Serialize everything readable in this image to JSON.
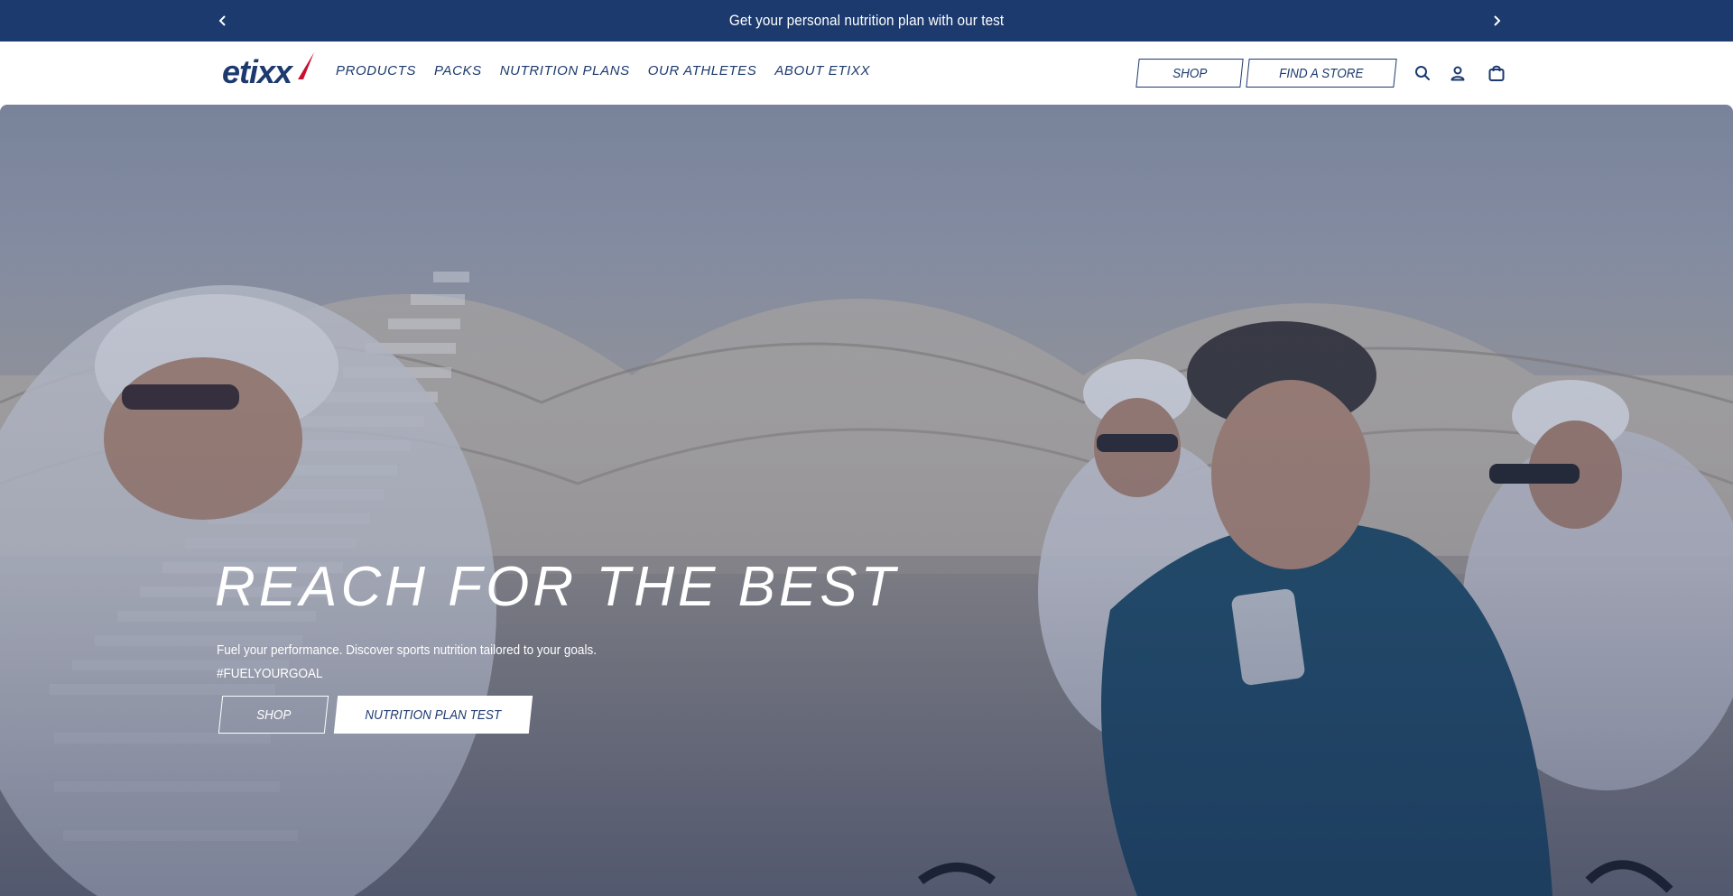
{
  "announcement": {
    "text": "Get your personal nutrition plan with our test",
    "prev_icon": "chevron-left-icon",
    "next_icon": "chevron-right-icon"
  },
  "header": {
    "logo_text": "etixx",
    "nav": [
      {
        "label": "PRODUCTS"
      },
      {
        "label": "PACKS"
      },
      {
        "label": "NUTRITION PLANS"
      },
      {
        "label": "OUR ATHLETES"
      },
      {
        "label": "ABOUT ETIXX"
      }
    ],
    "shop_label": "SHOP",
    "find_store_label": "FIND A STORE",
    "icons": [
      "search-icon",
      "account-icon",
      "cart-icon"
    ]
  },
  "hero": {
    "title": "REACH FOR THE BEST",
    "subtitle": "Fuel your performance. Discover sports nutrition tailored to your goals.",
    "hashtag": "#FUELYOURGOAL",
    "shop_label": "SHOP",
    "test_label": "NUTRITION PLAN TEST"
  },
  "colors": {
    "brand_navy": "#1c3a6e",
    "accent_red": "#c8102e",
    "white": "#ffffff"
  }
}
